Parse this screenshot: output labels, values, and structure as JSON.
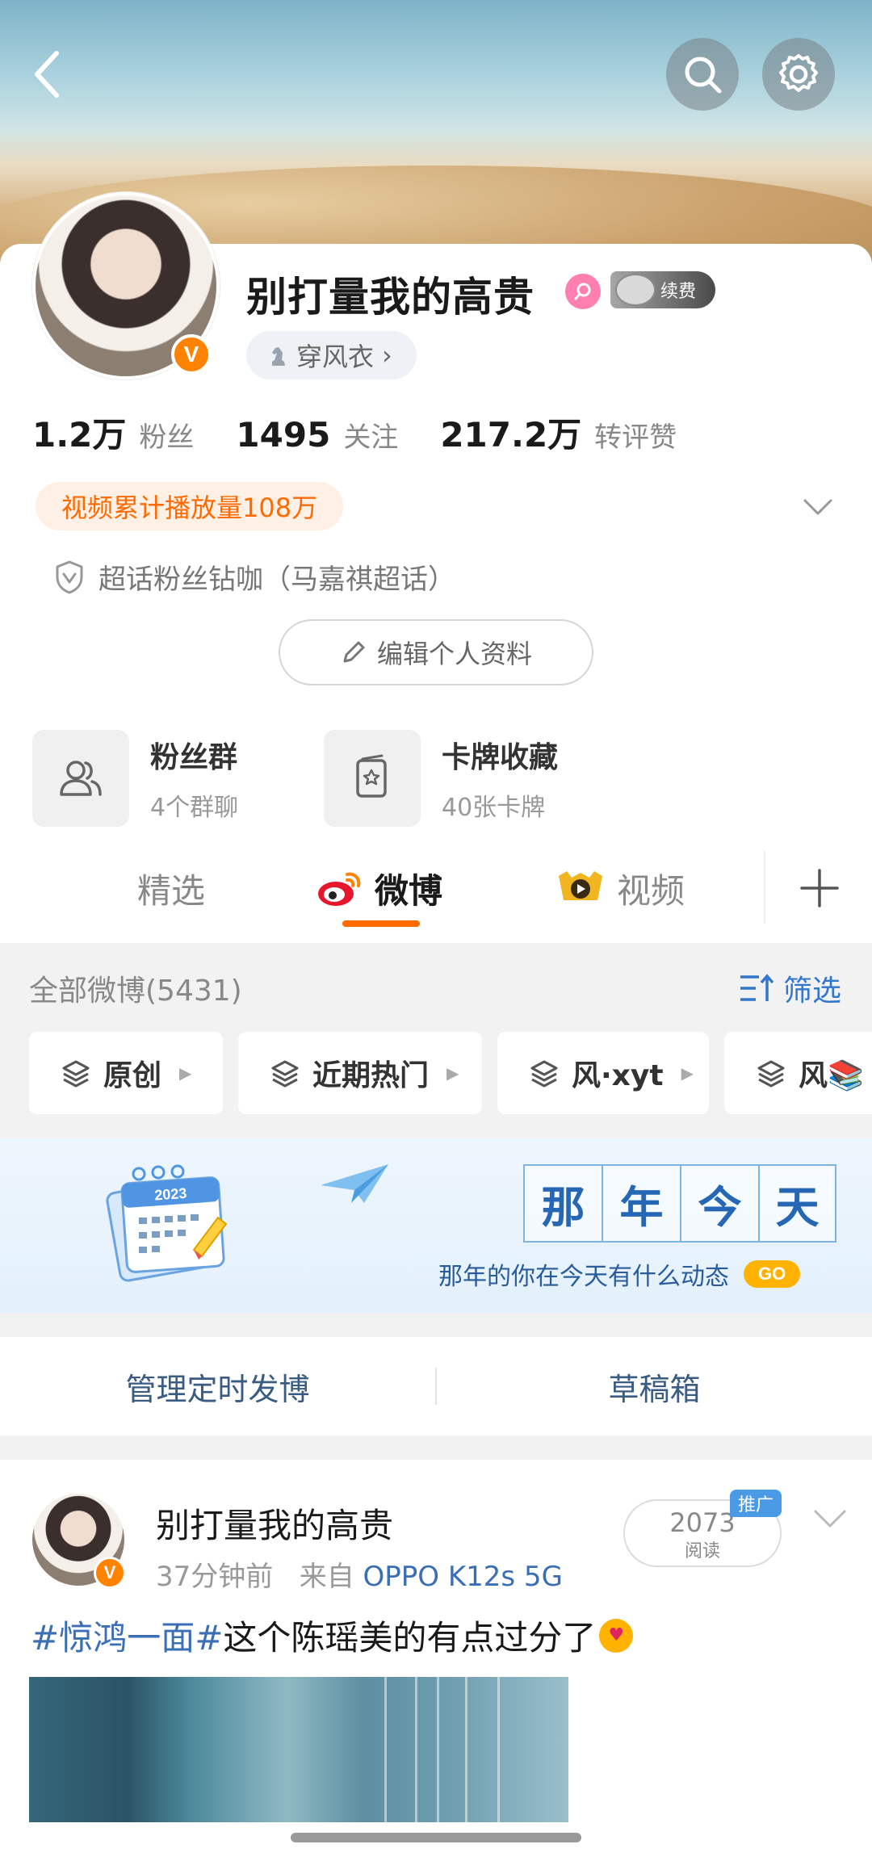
{
  "profile": {
    "username": "别打量我的高贵",
    "vip_label": "续费",
    "tag": "穿风衣",
    "tag_chevron": "›",
    "stats": [
      {
        "value": "1.2万",
        "label": "粉丝"
      },
      {
        "value": "1495",
        "label": "关注"
      },
      {
        "value": "217.2万",
        "label": "转评赞"
      }
    ],
    "video_stat": "视频累计播放量108万",
    "supertopic": "超话粉丝钻咖（马嘉祺超话）",
    "edit_label": "编辑个人资料",
    "verified_mark": "V"
  },
  "quick_tiles": [
    {
      "title": "粉丝群",
      "subtitle": "4个群聊"
    },
    {
      "title": "卡牌收藏",
      "subtitle": "40张卡牌"
    }
  ],
  "tabs": [
    {
      "label": "精选"
    },
    {
      "label": "微博"
    },
    {
      "label": "视频"
    }
  ],
  "feed": {
    "all_label": "全部微博(5431)",
    "filter_label": "筛选",
    "chips": [
      "原创",
      "近期热门",
      "风·xyt",
      "风📚"
    ]
  },
  "on_this_day": {
    "title_chars": [
      "那",
      "年",
      "今",
      "天"
    ],
    "subtitle": "那年的你在今天有什么动态",
    "go_label": "GO",
    "calendar_year": "2023"
  },
  "manage": {
    "scheduled": "管理定时发博",
    "drafts": "草稿箱"
  },
  "post": {
    "author": "别打量我的高贵",
    "time": "37分钟前",
    "source_prefix": "来自",
    "device": "OPPO K12s 5G",
    "read_count": "2073",
    "read_label": "阅读",
    "promo_label": "推广",
    "hashtag": "#惊鸿一面#",
    "text": "这个陈瑶美的有点过分了"
  },
  "colors": {
    "accent": "#ff6a00",
    "link": "#3a6eb5",
    "verified": "#ff8200"
  }
}
